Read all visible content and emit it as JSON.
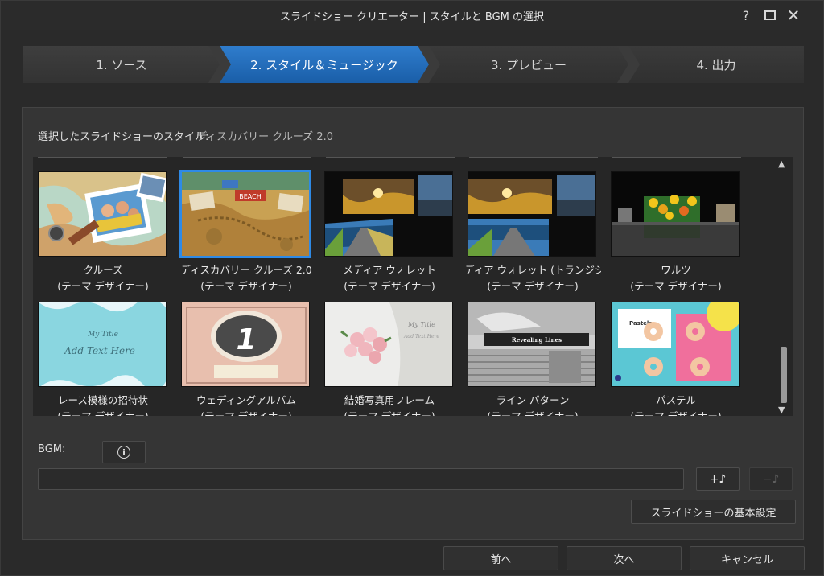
{
  "window": {
    "title": "スライドショー クリエーター | スタイルと BGM の選択"
  },
  "titlebar": {
    "help_glyph": "?",
    "close_glyph": "✕"
  },
  "steps": [
    {
      "label": "1. ソース"
    },
    {
      "label": "2. スタイル＆ミュージック"
    },
    {
      "label": "3. プレビュー"
    },
    {
      "label": "4. 出力"
    }
  ],
  "selection": {
    "label": "選択したスライドショーのスタイル:",
    "value": "ディスカバリー クルーズ 2.0"
  },
  "styles": [
    {
      "name": "クルーズ",
      "sub": "(テーマ デザイナー)"
    },
    {
      "name": "ディスカバリー クルーズ 2.0",
      "sub": "(テーマ デザイナー)"
    },
    {
      "name": "メディア ウォレット",
      "sub": "(テーマ デザイナー)"
    },
    {
      "name": "ディア ウォレット (トランジションあ",
      "sub": "(テーマ デザイナー)"
    },
    {
      "name": "ワルツ",
      "sub": "(テーマ デザイナー)"
    },
    {
      "name": "レース模様の招待状",
      "sub": "(テーマ デザイナー)"
    },
    {
      "name": "ウェディングアルバム",
      "sub": "(テーマ デザイナー)"
    },
    {
      "name": "結婚写真用フレーム",
      "sub": "(テーマ デザイナー)"
    },
    {
      "name": "ライン パターン",
      "sub": "(テーマ デザイナー)"
    },
    {
      "name": "パステル",
      "sub": "(テーマ デザイナー)"
    }
  ],
  "thumb_text": {
    "discovery_sign": "BEACH",
    "lace_title": "My Title",
    "lace_sub": "Add Text Here",
    "wedding_number": "1",
    "frame_title": "My Title",
    "frame_sub": "Add Text Here",
    "lines_caption": "Revealing Lines",
    "pastel_title": "Pastels"
  },
  "bgm": {
    "label": "BGM:",
    "info_glyph": "i",
    "add_glyph": "+♪",
    "remove_glyph": "−♪",
    "value": ""
  },
  "settings_button": "スライドショーの基本設定",
  "footer": {
    "back": "前へ",
    "next": "次へ",
    "cancel": "キャンセル"
  },
  "colors": {
    "accent": "#2e8ae6",
    "active_step": "#1f69b8",
    "background": "#2a2a2a"
  }
}
